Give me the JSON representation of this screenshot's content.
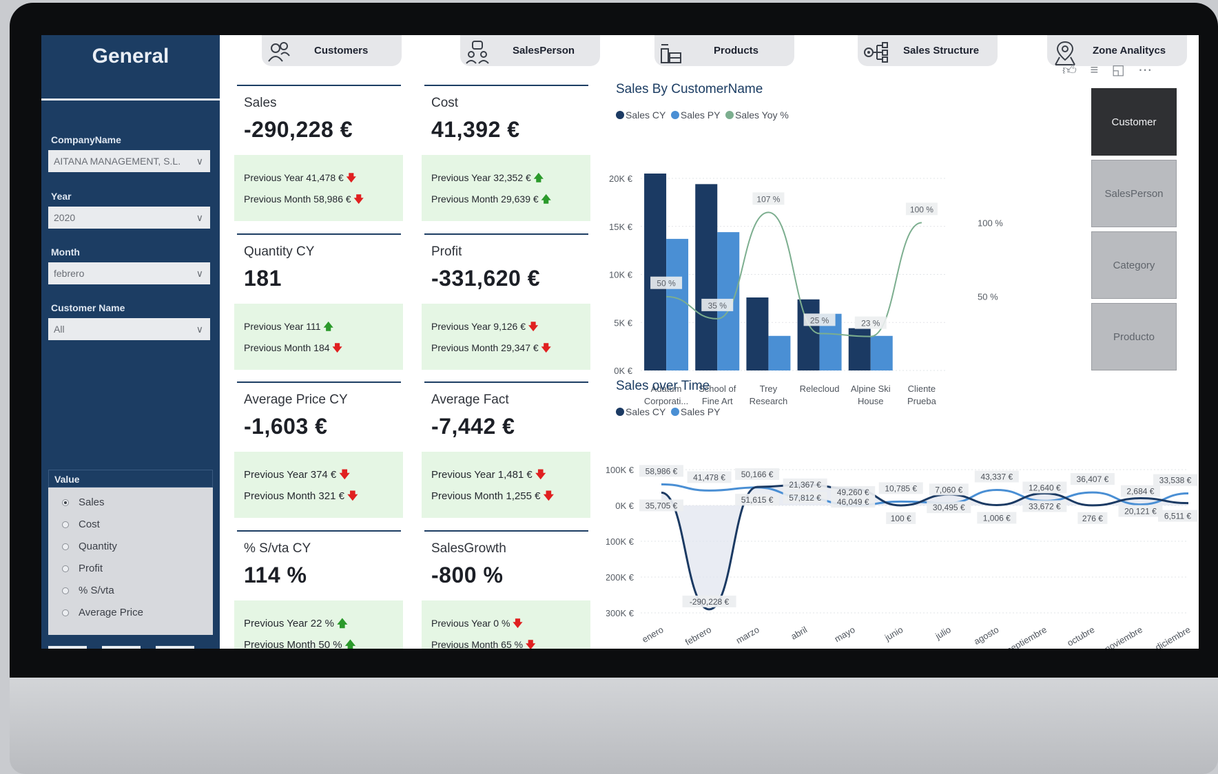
{
  "sidebar": {
    "title": "General",
    "filters": [
      {
        "label": "CompanyName",
        "value": "AITANA MANAGEMENT, S.L."
      },
      {
        "label": "Year",
        "value": "2020"
      },
      {
        "label": "Month",
        "value": "febrero"
      },
      {
        "label": "Customer Name",
        "value": "All"
      }
    ],
    "value_panel": {
      "title": "Value",
      "options": [
        "Sales",
        "Cost",
        "Quantity",
        "Profit",
        "% S/vta",
        "Average Price"
      ],
      "selected": "Sales"
    }
  },
  "nav": [
    {
      "label": "Customers",
      "icon": "people-icon"
    },
    {
      "label": "SalesPerson",
      "icon": "salesperson-icon"
    },
    {
      "label": "Products",
      "icon": "products-icon"
    },
    {
      "label": "Sales Structure",
      "icon": "structure-icon"
    },
    {
      "label": "Zone Analitycs",
      "icon": "location-pin-icon"
    }
  ],
  "kpis": [
    {
      "title": "Sales",
      "value": "-290,228 €",
      "line1": "Previous Year 41,478 €",
      "line1_trend": "down",
      "line2": "Previous Month 58,986 €",
      "line2_trend": "down"
    },
    {
      "title": "Cost",
      "value": "41,392 €",
      "line1": "Previous Year 32,352 €",
      "line1_trend": "up",
      "line2": "Previous Month 29,639 €",
      "line2_trend": "up"
    },
    {
      "title": "Quantity CY",
      "value": "181",
      "line1": "Previous Year 111",
      "line1_trend": "up",
      "line2": "Previous Month 184",
      "line2_trend": "down"
    },
    {
      "title": "Profit",
      "value": "-331,620 €",
      "line1": "Previous Year 9,126 €",
      "line1_trend": "down",
      "line2": "Previous Month 29,347 €",
      "line2_trend": "down"
    },
    {
      "title": "Average Price CY",
      "value": "-1,603 €",
      "line1": "Previous Year 374 €",
      "line1_trend": "down",
      "line2": "Previous Month 321 €",
      "line2_trend": "down"
    },
    {
      "title": "Average Fact",
      "value": "-7,442 €",
      "line1": "Previous Year 1,481 €",
      "line1_trend": "down",
      "line2": "Previous Month 1,255 €",
      "line2_trend": "down"
    },
    {
      "title": "% S/vta CY",
      "value": "114 %",
      "line1": "Previous Year 22 %",
      "line1_trend": "up",
      "line2": "Previous Month 50 %",
      "line2_trend": "up"
    },
    {
      "title": "SalesGrowth",
      "value": "-800 %",
      "line1": "Previous Year 0 %",
      "line1_trend": "down",
      "line2": "Previous Month 65 %",
      "line2_trend": "down"
    }
  ],
  "side_buttons": [
    {
      "label": "Customer",
      "active": true
    },
    {
      "label": "SalesPerson",
      "active": false
    },
    {
      "label": "Category",
      "active": false
    },
    {
      "label": "Producto",
      "active": false
    }
  ],
  "header_icons": [
    "thumbs-up-icon",
    "filter-icon",
    "focus-mode-icon",
    "more-options-icon"
  ],
  "colors": {
    "sidebar": "#1c3d63",
    "sales_cy": "#1b3a63",
    "sales_py": "#4a8fd4",
    "yoy": "#7cae8f",
    "kpi_box": "#e5f6e4",
    "up": "#2b9a2b",
    "down": "#e02020"
  },
  "chart_data": [
    {
      "type": "bar",
      "title": "Sales By CustomerName",
      "legend": [
        "Sales CY",
        "Sales PY",
        "Sales Yoy %"
      ],
      "categories": [
        "Adatum Corporati...",
        "School of Fine Art",
        "Trey Research",
        "Relecloud",
        "Alpine Ski House",
        "Cliente Prueba"
      ],
      "category_lines": [
        [
          "Adatum",
          "Corporati..."
        ],
        [
          "School of",
          "Fine Art"
        ],
        [
          "Trey",
          "Research"
        ],
        [
          "Relecloud"
        ],
        [
          "Alpine Ski",
          "House"
        ],
        [
          "Cliente",
          "Prueba"
        ]
      ],
      "series": [
        {
          "name": "Sales CY",
          "values": [
            20500,
            19400,
            7600,
            7400,
            4400,
            0
          ]
        },
        {
          "name": "Sales PY",
          "values": [
            13700,
            14400,
            3600,
            5900,
            3600,
            0
          ]
        }
      ],
      "line": {
        "name": "Sales Yoy %",
        "values": [
          50,
          35,
          107,
          25,
          23,
          100
        ]
      },
      "data_labels": [
        "50 %",
        "35 %",
        "107 %",
        "25 %",
        "23 %",
        "100 %"
      ],
      "y_ticks": [
        "20K €",
        "15K €",
        "10K €",
        "5K €",
        "0K €"
      ],
      "y2_ticks": [
        "100 %",
        "50 %"
      ],
      "ylim": [
        0,
        20000
      ],
      "y2lim": [
        0,
        130
      ]
    },
    {
      "type": "line",
      "title": "Sales over Time",
      "legend": [
        "Sales CY",
        "Sales PY"
      ],
      "x": [
        "enero",
        "febrero",
        "marzo",
        "abril",
        "mayo",
        "junio",
        "julio",
        "agosto",
        "septiembre",
        "octubre",
        "noviembre",
        "diciembre"
      ],
      "series": [
        {
          "name": "Sales CY",
          "values": [
            35705,
            -290228,
            51615,
            57812,
            46049,
            100,
            30495,
            1006,
            33672,
            276,
            20121,
            6511
          ]
        },
        {
          "name": "Sales PY",
          "values": [
            58986,
            41478,
            50166,
            21367,
            100,
            10785,
            7060,
            43337,
            12640,
            36407,
            2684,
            33538
          ]
        }
      ],
      "labels_cy": [
        "35,705 €",
        "-290,228 €",
        "51,615 €",
        "57,812 €",
        "46,049 €",
        "100 €",
        "30,495 €",
        "1,006 €",
        "33,672 €",
        "276 €",
        "20,121 €",
        "6,511 €"
      ],
      "labels_py": [
        "58,986 €",
        "41,478 €",
        "50,166 €",
        "21,367 €",
        "49,260 €",
        "10,785 €",
        "7,060 €",
        "43,337 €",
        "12,640 €",
        "36,407 €",
        "2,684 €",
        "33,538 €"
      ],
      "y_ticks": [
        "100K €",
        "0K €",
        "-100K €",
        "-200K €",
        "-300K €"
      ],
      "ylim": [
        -300000,
        100000
      ]
    }
  ]
}
